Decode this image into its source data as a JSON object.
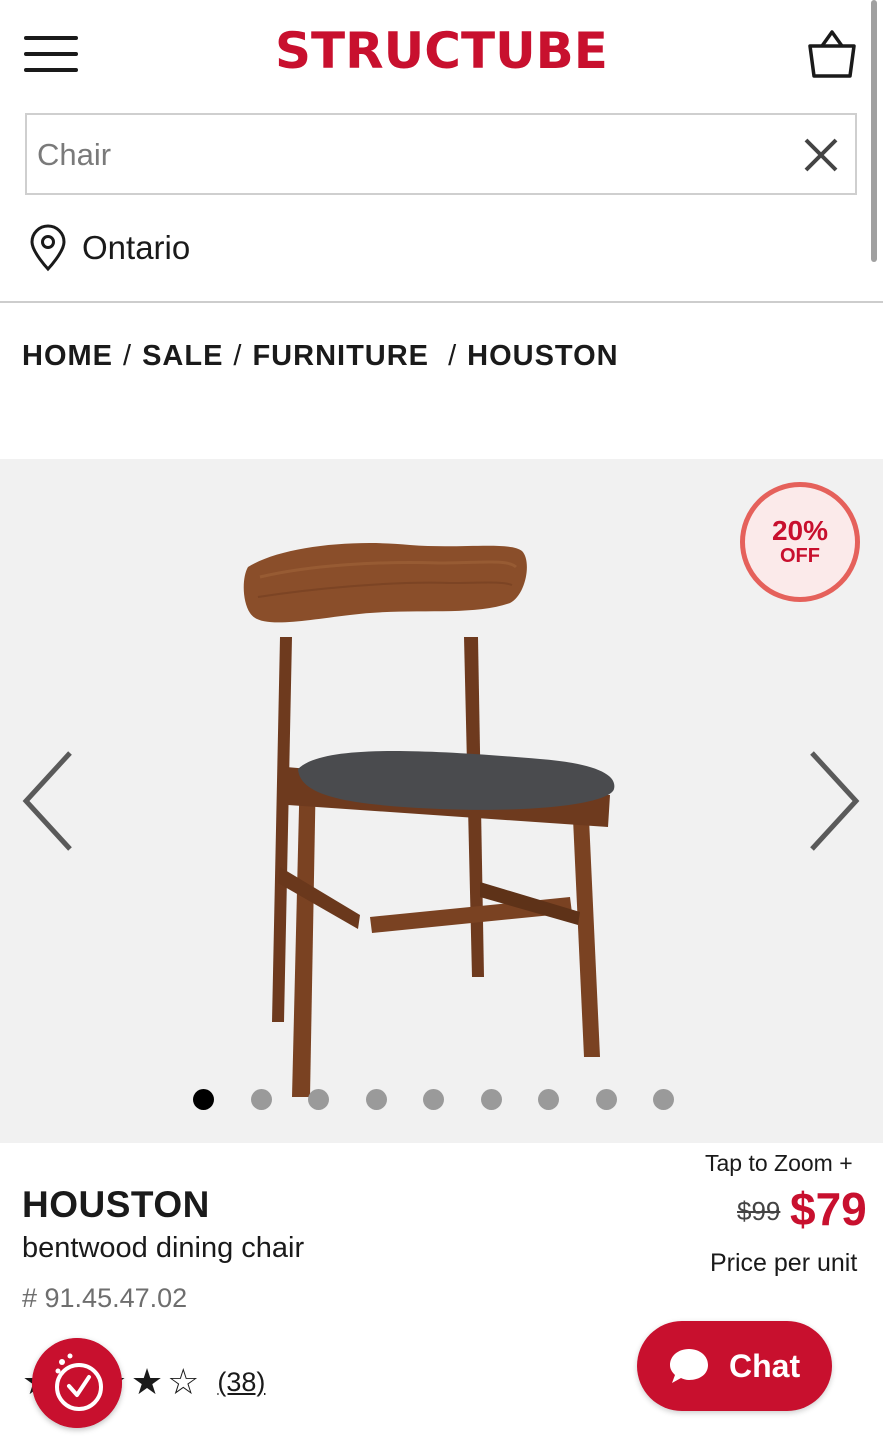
{
  "header": {
    "logo": "STRUCTUBE",
    "menu_icon": "hamburger-menu-icon",
    "cart_icon": "shopping-bag-icon"
  },
  "search": {
    "value": "",
    "placeholder": "Chair",
    "clear_icon": "close-icon"
  },
  "location": {
    "icon": "map-pin-icon",
    "label": "Ontario"
  },
  "breadcrumb": [
    "HOME",
    "SALE",
    "FURNITURE",
    "HOUSTON"
  ],
  "gallery": {
    "badge_percent": "20%",
    "badge_off": "OFF",
    "prev_icon": "chevron-left-icon",
    "next_icon": "chevron-right-icon",
    "image_count": 9,
    "active_image": 1
  },
  "product": {
    "name": "HOUSTON",
    "description": "bentwood dining chair",
    "sku": "# 91.45.47.02",
    "zoom_label": "Tap to Zoom +",
    "price_old": "$99",
    "price_new": "$79",
    "price_unit": "Price per unit",
    "rating": 4,
    "rating_max": 5,
    "reviews": "(38)"
  },
  "chat": {
    "label": "Chat",
    "icon": "chat-bubble-icon"
  },
  "colors": {
    "brand": "#c8102e",
    "badge_border": "#e5615b",
    "gallery_bg": "#f1f1f1"
  }
}
